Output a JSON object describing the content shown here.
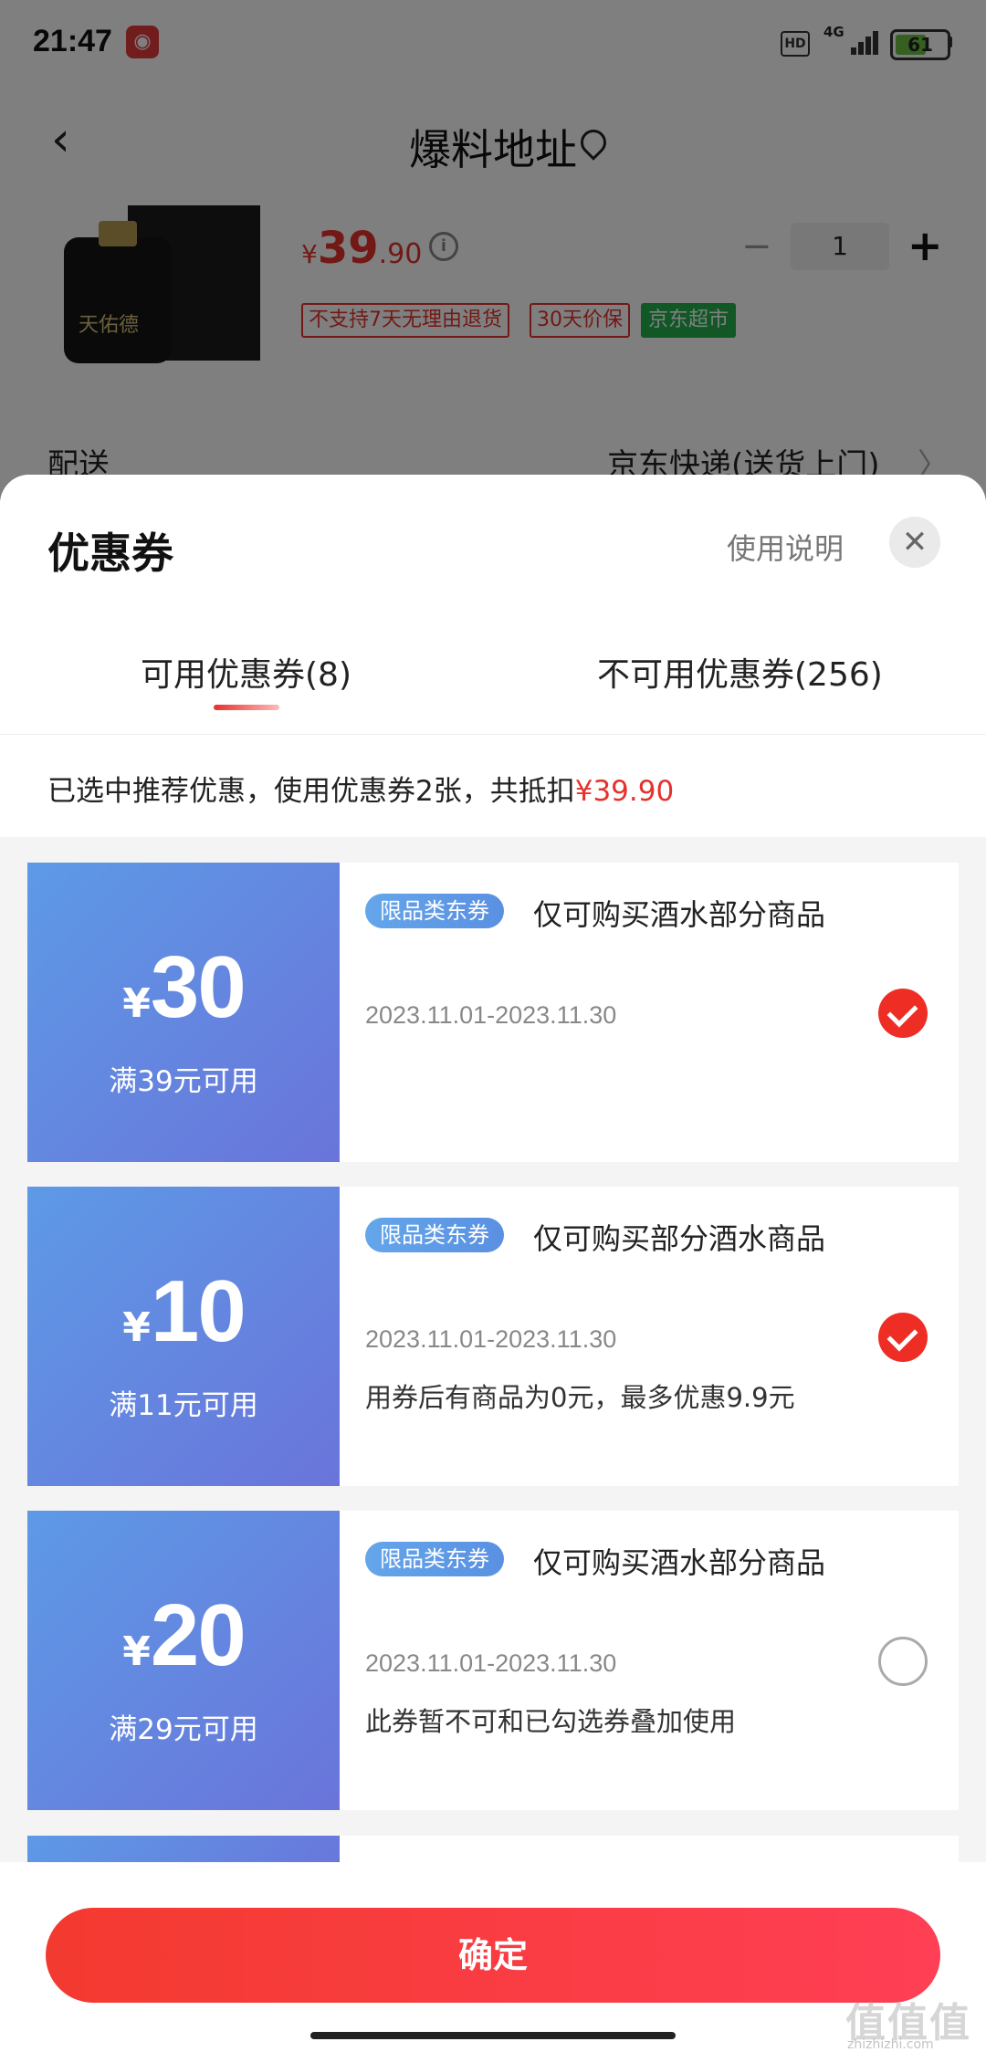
{
  "status_bar": {
    "time": "21:47",
    "hd": "HD",
    "network": "4G",
    "battery": "61",
    "battery_level": 0.61
  },
  "header": {
    "title": "爆料地址"
  },
  "product": {
    "price_yen": "¥",
    "price_int": "39",
    "price_dec": ".90",
    "quantity": "1",
    "tags": [
      "不支持7天无理由退货",
      "30天价保",
      "京东超市"
    ],
    "brand_text": "天佑德"
  },
  "delivery": {
    "label": "配送",
    "value": "京东快递(送货上门)"
  },
  "sheet": {
    "title": "优惠券",
    "usage_link": "使用说明",
    "tabs": [
      {
        "label": "可用优惠券(8)",
        "active": true
      },
      {
        "label": "不可用优惠券(256)",
        "active": false
      }
    ],
    "summary_prefix": "已选中推荐优惠，使用优惠券2张，共抵扣",
    "summary_amount": "¥39.90"
  },
  "coupons": [
    {
      "yen": "¥",
      "amount": "30",
      "condition": "满39元可用",
      "badge": "限品类东券",
      "title": "仅可购买酒水部分商品",
      "date": "2023.11.01-2023.11.30",
      "note": "",
      "selected": true
    },
    {
      "yen": "¥",
      "amount": "10",
      "condition": "满11元可用",
      "badge": "限品类东券",
      "title": "仅可购买部分酒水商品",
      "date": "2023.11.01-2023.11.30",
      "note": "用券后有商品为0元，最多优惠9.9元",
      "selected": true
    },
    {
      "yen": "¥",
      "amount": "20",
      "condition": "满29元可用",
      "badge": "限品类东券",
      "title": "仅可购买酒水部分商品",
      "date": "2023.11.01-2023.11.30",
      "note": "此券暂不可和已勾选券叠加使用",
      "selected": false
    }
  ],
  "footer": {
    "confirm_label": "确定",
    "watermark": "值值值",
    "watermark_sub": "zhizhizhi.com"
  },
  "colors": {
    "accent_red": "#e5322d",
    "coupon_blue": "#5d9ae6",
    "coupon_purple": "#6a74da",
    "tag_green": "#22b04d"
  }
}
